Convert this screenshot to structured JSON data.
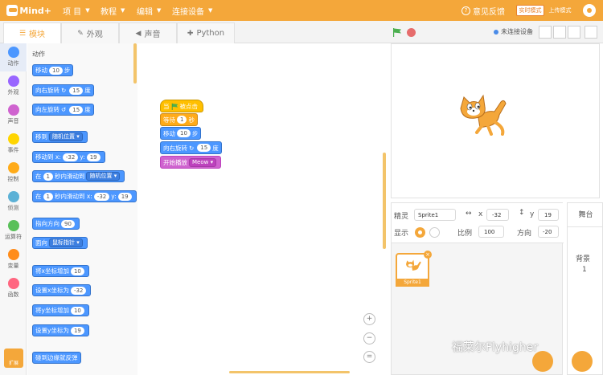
{
  "app": {
    "logo_text": "Mind+"
  },
  "menubar": {
    "items": [
      "项 目",
      "教程",
      "编辑",
      "连接设备"
    ],
    "feedback": "意见反馈",
    "mode_realtime": "实时模式",
    "mode_upload": "上传模式"
  },
  "tabs": [
    "模块",
    "外观",
    "声音",
    "Python"
  ],
  "connection_status": "未连接设备",
  "categories": [
    "动作",
    "外观",
    "声音",
    "事件",
    "控制",
    "侦测",
    "运算符",
    "变量",
    "函数"
  ],
  "extension_button": "扩展",
  "palette": {
    "heading": "动作",
    "blocks": {
      "move": {
        "text": "移动",
        "value": "10",
        "unit": "步"
      },
      "turn_right": {
        "text": "向右旋转",
        "value": "15",
        "unit": "度"
      },
      "turn_left": {
        "text": "向左旋转",
        "value": "15",
        "unit": "度"
      },
      "goto": {
        "text": "移到",
        "dropdown": "随机位置"
      },
      "goto_xy": {
        "text": "移动到 x:",
        "x": "-32",
        "ylabel": "y:",
        "y": "19"
      },
      "glide": {
        "text": "在",
        "secs": "1",
        "mid": "秒内滑动到",
        "dropdown": "随机位置"
      },
      "glide_xy": {
        "text": "在",
        "secs": "1",
        "mid": "秒内滑动到 x:",
        "x": "-32",
        "ylabel": "y:",
        "y": "19"
      },
      "point_dir": {
        "text": "指向方向",
        "value": "90"
      },
      "point_towards": {
        "text": "面向",
        "dropdown": "鼠标指针"
      },
      "change_x": {
        "text": "将x坐标增加",
        "value": "10"
      },
      "set_x": {
        "text": "设置x坐标为",
        "value": "-32"
      },
      "change_y": {
        "text": "将y坐标增加",
        "value": "10"
      },
      "set_y": {
        "text": "设置y坐标为",
        "value": "19"
      },
      "bounce": {
        "text": "碰到边缘就反弹"
      }
    }
  },
  "script": {
    "hat": {
      "before": "当",
      "after": "被点击"
    },
    "wait": {
      "text": "等待",
      "value": "1",
      "unit": "秒"
    },
    "move": {
      "text": "移动",
      "value": "10",
      "unit": "步"
    },
    "turn": {
      "text": "向右旋转",
      "value": "15",
      "unit": "度"
    },
    "sound": {
      "text": "开始播放",
      "dropdown": "Meow"
    }
  },
  "zoom_buttons": [
    "+",
    "−",
    "="
  ],
  "sprite_info": {
    "sprite_label": "精灵",
    "sprite_name": "Sprite1",
    "x_label": "x",
    "x": "-32",
    "y_label": "y",
    "y": "19",
    "show_label": "显示",
    "size_label": "比例",
    "size": "100",
    "direction_label": "方向",
    "direction": "-20"
  },
  "sprite_thumb": {
    "name": "Sprite1",
    "delete": "×"
  },
  "backdrop": {
    "title": "舞台",
    "label": "背景",
    "count": "1"
  },
  "watermark": "福莱尔Flyhigher",
  "colors": {
    "accent": "#f4a73a",
    "motion": "#4c97ff",
    "event": "#ffbf00",
    "control": "#ffab19",
    "sound": "#cf63cf"
  }
}
